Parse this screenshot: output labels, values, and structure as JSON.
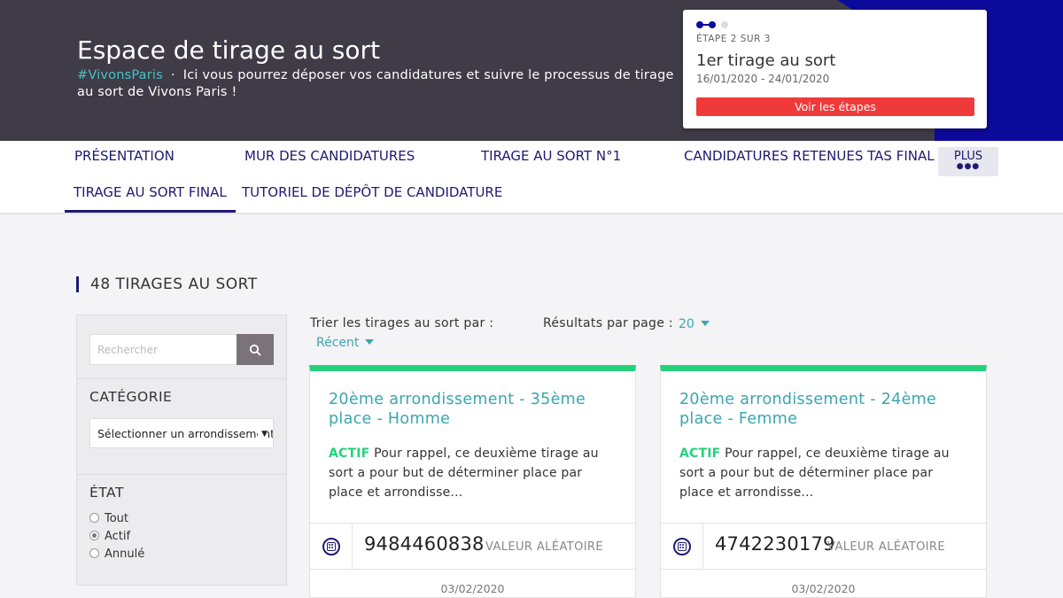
{
  "header": {
    "title": "Espace de tirage au sort",
    "hashtag": "#VivonsParis",
    "description": "Ici vous pourrez déposer vos candidatures et suivre le processus de tirage au sort de Vivons Paris !"
  },
  "step_card": {
    "label": "ÉTAPE 2 SUR 3",
    "title": "1er tirage au sort",
    "dates": "16/01/2020 - 24/01/2020",
    "button": "Voir les étapes"
  },
  "nav": {
    "items": [
      "PRÉSENTATION",
      "MUR DES CANDIDATURES",
      "TIRAGE AU SORT N°1",
      "CANDIDATURES RETENUES TAS FINAL",
      "TIRAGE AU SORT FINAL",
      "TUTORIEL DE DÉPÔT DE CANDIDATURE"
    ],
    "more": "PLUS",
    "more_dots": "●●●",
    "active": "TIRAGE AU SORT FINAL"
  },
  "section_title": "48 TIRAGES AU SORT",
  "sidebar": {
    "search_placeholder": "Rechercher",
    "category_heading": "CATÉGORIE",
    "category_select": "Sélectionner un arrondissement",
    "state_heading": "ÉTAT",
    "states": [
      "Tout",
      "Actif",
      "Annulé"
    ],
    "selected_state": "Actif"
  },
  "controls": {
    "sort_label": "Trier les tirages au sort par :",
    "sort_value": "Récent",
    "results_label": "Résultats par page :",
    "results_value": "20"
  },
  "cards": [
    {
      "title": "20ème arrondissement - 35ème place - Homme",
      "status": "ACTIF",
      "description": "Pour rappel, ce deuxième tirage au sort a pour but de déterminer place par place et arrondisse...",
      "random_value": "9484460838",
      "random_label": "VALEUR ALÉATOIRE",
      "date": "03/02/2020"
    },
    {
      "title": "20ème arrondissement - 24ème place - Femme",
      "status": "ACTIF",
      "description": "Pour rappel, ce deuxième tirage au sort a pour but de déterminer place par place et arrondisse...",
      "random_value": "4742230179",
      "random_label": "VALEUR ALÉATOIRE",
      "date": "03/02/2020"
    }
  ],
  "colors": {
    "header_bg": "#3f3b47",
    "brand_blue": "#0c0a9a",
    "nav_text": "#1e1a73",
    "teal": "#3aa6b0",
    "green": "#23d27a",
    "red_button": "#f03a3a"
  }
}
